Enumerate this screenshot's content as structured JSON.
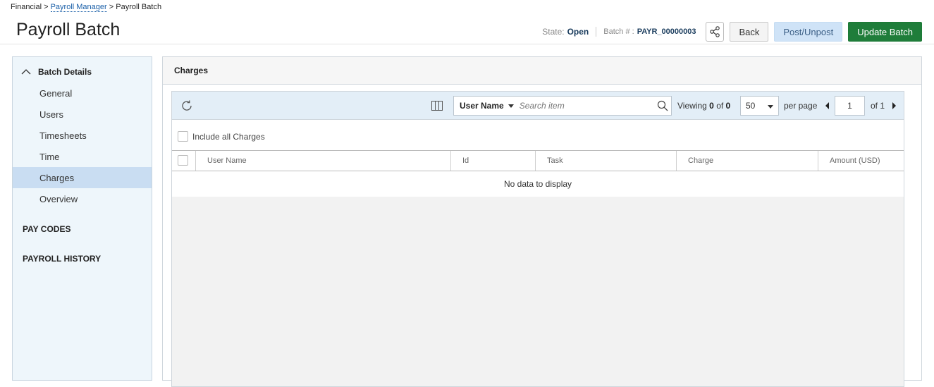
{
  "breadcrumb": {
    "root": "Financial",
    "sep1": ">",
    "parent": "Payroll Manager",
    "sep2": ">",
    "current": "Payroll Batch"
  },
  "header": {
    "title": "Payroll Batch",
    "state_label": "State:",
    "state_value": "Open",
    "batch_label": "Batch # :",
    "batch_value": "PAYR_00000003",
    "back_label": "Back",
    "post_label": "Post/Unpost",
    "update_label": "Update Batch"
  },
  "sidebar": {
    "section_label": "Batch Details",
    "items": [
      {
        "label": "General"
      },
      {
        "label": "Users"
      },
      {
        "label": "Timesheets"
      },
      {
        "label": "Time"
      },
      {
        "label": "Charges"
      },
      {
        "label": "Overview"
      }
    ],
    "active_item": "Charges",
    "pay_codes_label": "PAY CODES",
    "payroll_history_label": "PAYROLL HISTORY"
  },
  "panel": {
    "title": "Charges",
    "search": {
      "field": "User Name",
      "placeholder": "Search item"
    },
    "viewing": {
      "label": "Viewing",
      "from": "0",
      "of_label": "of",
      "total": "0"
    },
    "per_page_value": "50",
    "per_page_label": "per page",
    "page_value": "1",
    "of_pages_label": "of 1",
    "include_label": "Include all Charges",
    "columns": [
      "User Name",
      "Id",
      "Task",
      "Charge",
      "Amount (USD)"
    ],
    "no_data": "No data to display"
  },
  "colors": {
    "accent": "#1f7d3a",
    "post_bg": "#cfe3f7",
    "active_item": "#c9ddf2",
    "sidebar_bg": "#eef6fb"
  }
}
